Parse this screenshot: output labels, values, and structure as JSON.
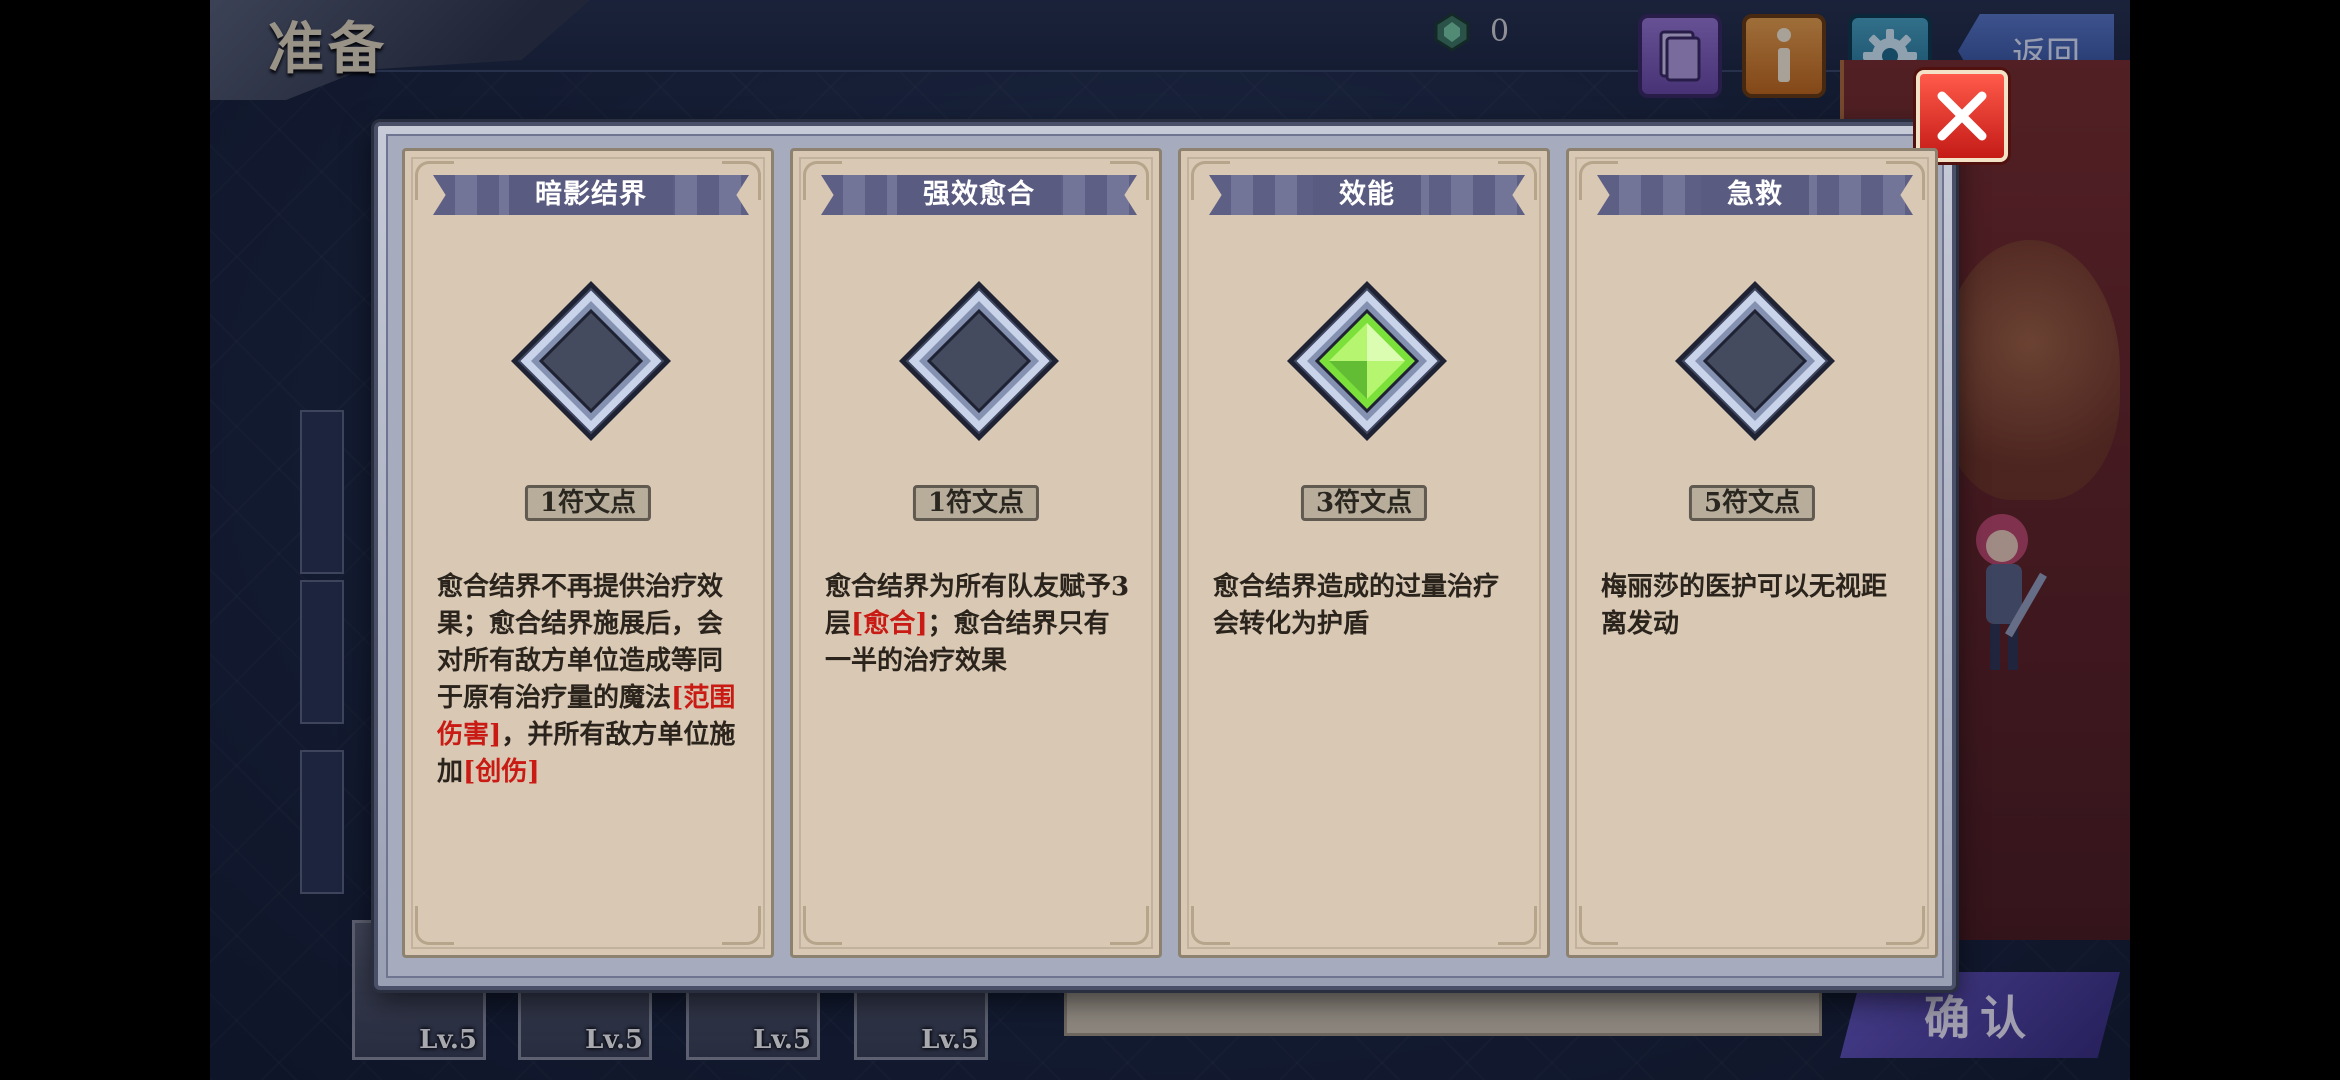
{
  "header": {
    "title": "准备",
    "gem_count": "0",
    "back_label": "返回"
  },
  "footer": {
    "confirm_label": "确认",
    "levels": [
      "Lv.5",
      "Lv.5",
      "Lv.5",
      "Lv.5"
    ]
  },
  "modal": {
    "cards": [
      {
        "name": "暗影结界",
        "cost": "1符文点",
        "selected": false,
        "desc_parts": [
          "愈合结界不再提供治疗效果；愈合结界施展后，会对所有敌方单位造成等同于原有治疗量的魔法",
          "[范围伤害]",
          "，并所有敌方单位施加",
          "[创伤]"
        ]
      },
      {
        "name": "强效愈合",
        "cost": "1符文点",
        "selected": false,
        "desc_parts": [
          "愈合结界为所有队友赋予3层",
          "[愈合]",
          "；愈合结界只有一半的治疗效果"
        ]
      },
      {
        "name": "效能",
        "cost": "3符文点",
        "selected": true,
        "desc_parts": [
          "愈合结界造成的过量治疗会转化为护盾"
        ]
      },
      {
        "name": "急救",
        "cost": "5符文点",
        "selected": false,
        "desc_parts": [
          "梅丽莎的医护可以无视距离发动"
        ]
      }
    ]
  },
  "colors": {
    "highlight": "#c91a14",
    "close": "#d8261f",
    "gem_active": "#7be03a",
    "gem_empty": "#454b5e"
  },
  "icons": [
    "gem-currency-icon",
    "book-icon",
    "info-icon",
    "gear-icon",
    "close-icon",
    "rune-socket-icon"
  ]
}
